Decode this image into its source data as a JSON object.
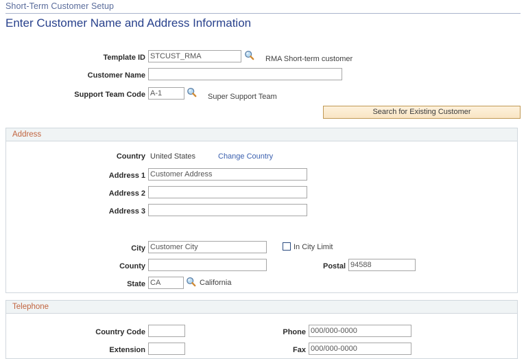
{
  "breadcrumb": {
    "text": "Short-Term Customer Setup"
  },
  "page": {
    "title": "Enter Customer Name and Address Information"
  },
  "top_form": {
    "template_id": {
      "label": "Template ID",
      "value": "STCUST_RMA",
      "lookup_icon": "magnifier-icon",
      "description": "RMA Short-term customer"
    },
    "customer_name": {
      "label": "Customer Name",
      "value": ""
    },
    "support_team_code": {
      "label": "Support Team Code",
      "value": "A-1",
      "lookup_icon": "magnifier-icon",
      "description": "Super Support Team"
    },
    "search_button": {
      "label": "Search for Existing Customer"
    }
  },
  "address": {
    "section_title": "Address",
    "country": {
      "label": "Country",
      "value": "United States",
      "change_link": "Change Country"
    },
    "address1": {
      "label": "Address 1",
      "value": "Customer Address"
    },
    "address2": {
      "label": "Address 2",
      "value": ""
    },
    "address3": {
      "label": "Address 3",
      "value": ""
    },
    "city": {
      "label": "City",
      "value": "Customer City"
    },
    "in_city_limit": {
      "label": "In City Limit",
      "checked": false
    },
    "county": {
      "label": "County",
      "value": ""
    },
    "postal": {
      "label": "Postal",
      "value": "94588"
    },
    "state": {
      "label": "State",
      "value": "CA",
      "lookup_icon": "magnifier-icon",
      "description": "California"
    }
  },
  "telephone": {
    "section_title": "Telephone",
    "country_code": {
      "label": "Country Code",
      "value": ""
    },
    "extension": {
      "label": "Extension",
      "value": ""
    },
    "phone": {
      "label": "Phone",
      "value": "000/000-0000"
    },
    "fax": {
      "label": "Fax",
      "value": "000/000-0000"
    }
  },
  "colors": {
    "breadcrumb": "#5a6c9b",
    "title": "#28418c",
    "link": "#3a5fae",
    "section_title": "#c1643f",
    "button_border": "#c09853",
    "button_fill": "#f9e5c4",
    "checkbox_border": "#2b4b80"
  }
}
